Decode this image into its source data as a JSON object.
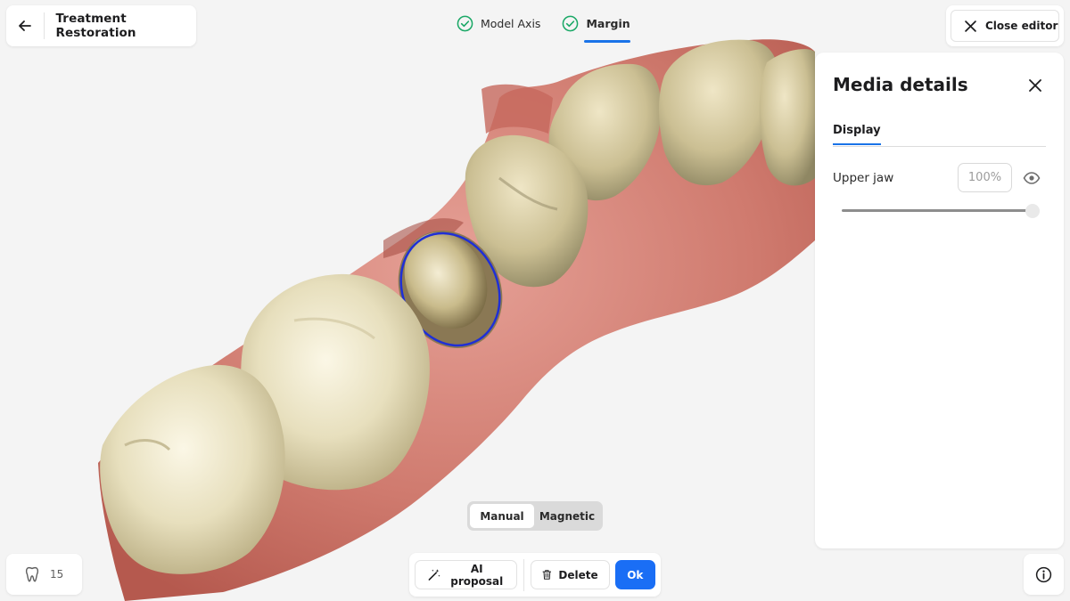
{
  "header": {
    "back_icon": "arrow-left-icon",
    "title": "Treatment Restoration",
    "steps": [
      {
        "label": "Model Axis",
        "status": "complete",
        "active": false,
        "icon": "check-circle-icon"
      },
      {
        "label": "Margin",
        "status": "complete",
        "active": true,
        "icon": "check-circle-icon"
      }
    ],
    "close_editor": {
      "label": "Close editor",
      "icon": "close-icon"
    }
  },
  "panel": {
    "title": "Media details",
    "close_icon": "close-icon",
    "tabs": [
      {
        "label": "Display",
        "active": true
      }
    ],
    "layers": [
      {
        "label": "Upper jaw",
        "opacity_text": "100%",
        "opacity_fraction": 1.0,
        "visible": true,
        "visibility_icon": "eye-icon"
      }
    ]
  },
  "mode_toggle": {
    "options": [
      "Manual",
      "Magnetic"
    ],
    "selected": "Manual"
  },
  "tooth_selector": {
    "icon": "tooth-icon",
    "number": "15"
  },
  "actions": {
    "ai_proposal": {
      "label": "AI proposal",
      "icon": "magic-wand-icon"
    },
    "delete": {
      "label": "Delete",
      "icon": "trash-icon"
    },
    "ok": {
      "label": "Ok"
    }
  },
  "info_icon": "info-icon",
  "colors": {
    "accent": "#1a73e8",
    "ok_button": "#1a6ef5",
    "step_check": "#1aa866",
    "margin_line": "#1f2fd6",
    "gingiva": "#d98679",
    "tooth": "#e9e1c2"
  }
}
